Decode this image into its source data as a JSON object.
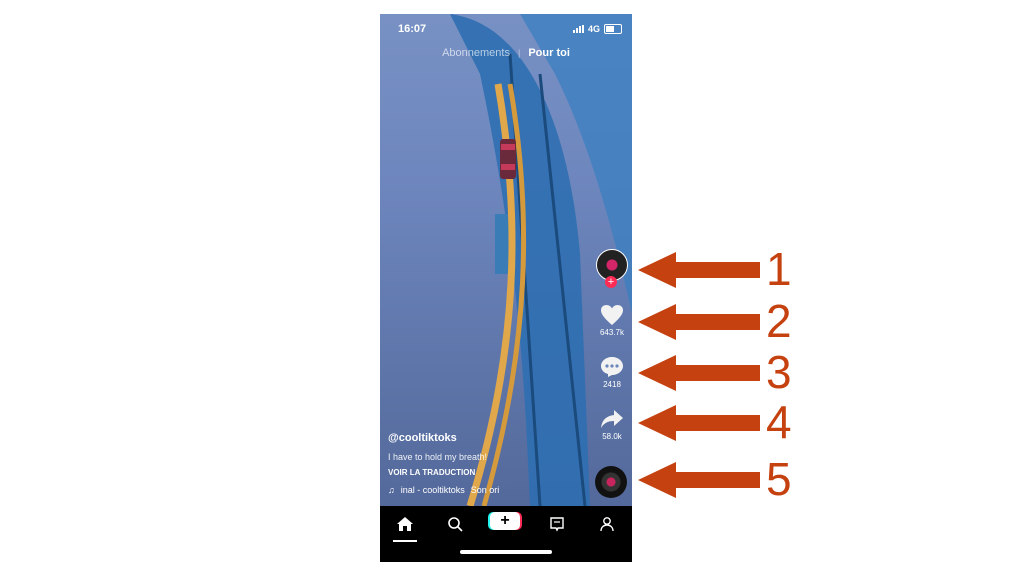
{
  "status_bar": {
    "time": "16:07",
    "network": "4G"
  },
  "top_tabs": {
    "following": "Abonnements",
    "for_you": "Pour toi"
  },
  "sidebar": {
    "likes": "643.7k",
    "comments": "2418",
    "shares": "58.0k"
  },
  "video_info": {
    "username": "@cooltiktoks",
    "caption": "I have to hold my breath!",
    "translate": "VOIR LA TRADUCTION",
    "music": "inal - cooltiktoks",
    "music_tail": "Son ori"
  },
  "annotations": {
    "numbers": [
      "1",
      "2",
      "3",
      "4",
      "5"
    ],
    "arrow_color": "#c5410f"
  },
  "colors": {
    "accent_red": "#fe2c55",
    "accent_cyan": "#25f4ee"
  }
}
